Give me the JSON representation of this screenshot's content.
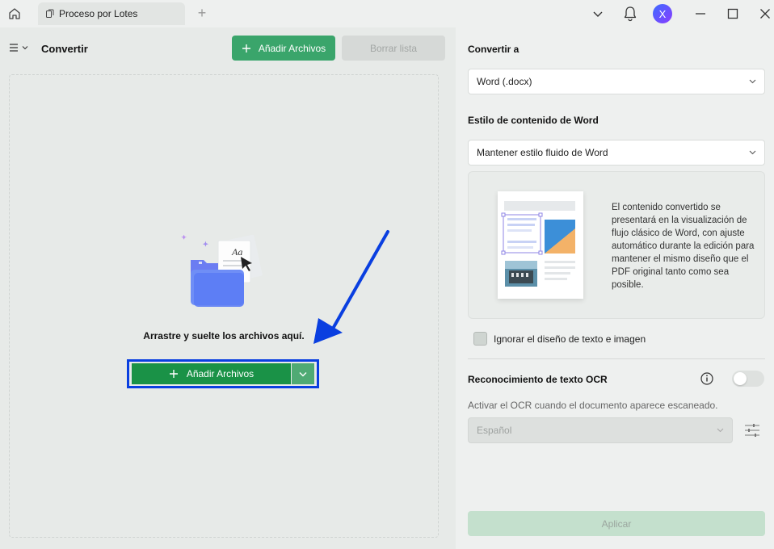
{
  "titlebar": {
    "tab_label": "Proceso por Lotes",
    "avatar_letter": "X"
  },
  "left": {
    "title": "Convertir",
    "add_files_label": "Añadir Archivos",
    "clear_list_label": "Borrar lista",
    "drop_text": "Arrastre y suelte los archivos aquí.",
    "add_files_main_label": "Añadir Archivos",
    "illustration_text": "Aa"
  },
  "right": {
    "convert_to_label": "Convertir a",
    "convert_to_value": "Word (.docx)",
    "word_style_label": "Estilo de contenido de Word",
    "word_style_value": "Mantener estilo fluido de Word",
    "preview_description": "El contenido convertido se presentará en la visualización de flujo clásico de Word, con ajuste automático durante la edición para mantener el mismo diseño que el PDF original tanto como sea posible.",
    "ignore_layout_label": "Ignorar el diseño de texto e imagen",
    "ignore_layout_checked": false,
    "ocr_label": "Reconocimiento de texto OCR",
    "ocr_enabled": false,
    "ocr_description": "Activar el OCR cuando el documento aparece escaneado.",
    "ocr_language": "Español",
    "apply_label": "Aplicar"
  },
  "colors": {
    "primary_green": "#3aa56b",
    "main_button_green": "#1a9247",
    "highlight_blue": "#0a3fe0"
  },
  "icons": [
    "home-icon",
    "document-icon",
    "plus-icon",
    "chevron-down-icon",
    "bell-icon",
    "minimize-icon",
    "maximize-icon",
    "close-icon",
    "menu-icon",
    "info-icon",
    "sliders-icon"
  ]
}
